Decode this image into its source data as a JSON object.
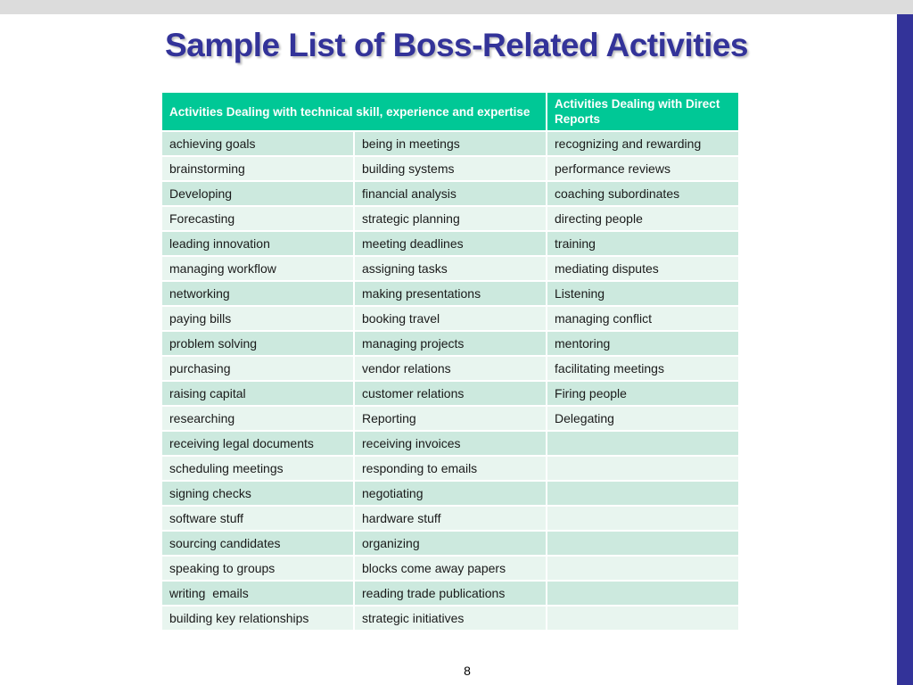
{
  "slide": {
    "title": "Sample List of Boss-Related Activities",
    "page_number": "8"
  },
  "table": {
    "headers": [
      "Activities Dealing with technical skill, experience and expertise",
      "Activities Dealing with Direct Reports"
    ],
    "rows": [
      [
        "achieving goals",
        "being in meetings",
        "recognizing and rewarding"
      ],
      [
        "brainstorming",
        "building systems",
        "performance reviews"
      ],
      [
        "Developing",
        "financial analysis",
        "coaching subordinates"
      ],
      [
        "Forecasting",
        "strategic planning",
        "directing people"
      ],
      [
        "leading innovation",
        "meeting deadlines",
        "training"
      ],
      [
        "managing workflow",
        "assigning tasks",
        "mediating disputes"
      ],
      [
        "networking",
        "making presentations",
        "Listening"
      ],
      [
        "paying bills",
        "booking travel",
        "managing conflict"
      ],
      [
        "problem solving",
        "managing projects",
        "mentoring"
      ],
      [
        "purchasing",
        "vendor relations",
        "facilitating meetings"
      ],
      [
        "raising capital",
        "customer relations",
        "Firing people"
      ],
      [
        "researching",
        "Reporting",
        "Delegating"
      ],
      [
        "receiving legal documents",
        "receiving invoices",
        ""
      ],
      [
        "scheduling meetings",
        "responding to emails",
        ""
      ],
      [
        "signing checks",
        "negotiating",
        ""
      ],
      [
        "software stuff",
        "hardware stuff",
        ""
      ],
      [
        "sourcing candidates",
        "organizing",
        ""
      ],
      [
        "speaking to groups",
        "blocks come away papers",
        ""
      ],
      [
        "writing  emails",
        "reading trade publications",
        ""
      ],
      [
        "building key relationships",
        "strategic initiatives",
        ""
      ]
    ]
  },
  "colors": {
    "title": "#333399",
    "header_bg": "#00c896",
    "row_odd": "#cce9de",
    "row_even": "#e8f5ef",
    "accent_bar": "#333399"
  }
}
